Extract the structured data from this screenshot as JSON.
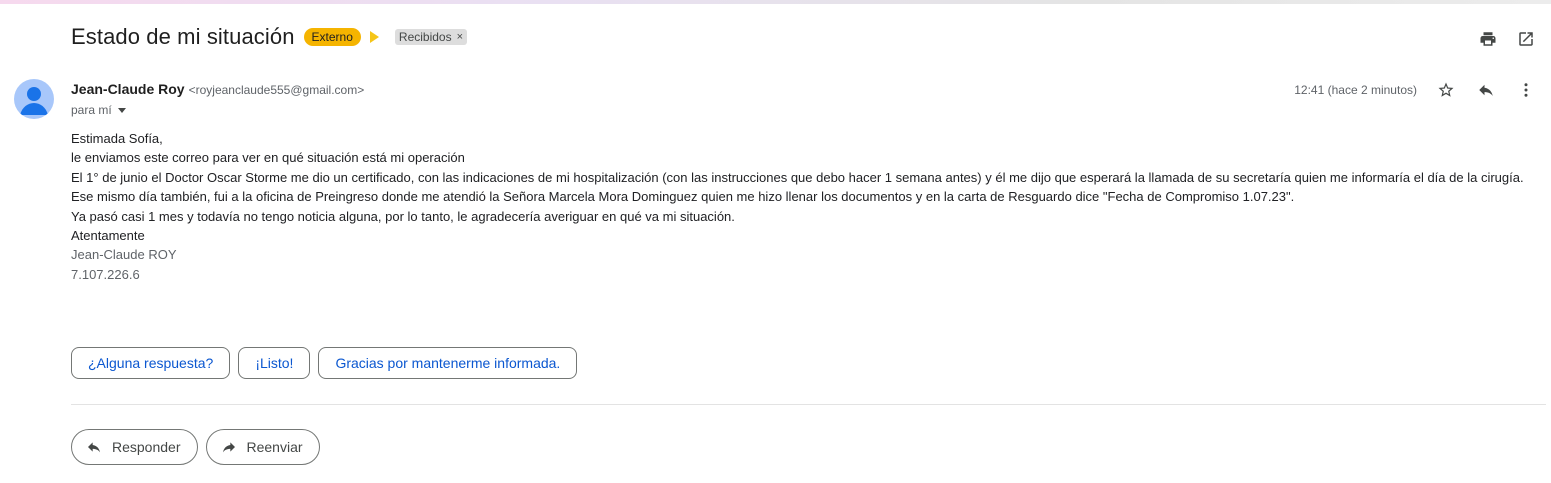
{
  "header": {
    "subject": "Estado de mi situación",
    "external_badge": "Externo",
    "label": "Recibidos",
    "label_remove": "×"
  },
  "sender": {
    "name": "Jean-Claude Roy",
    "email": "<royjeanclaude555@gmail.com>",
    "to": "para mí",
    "time": "12:41 (hace 2 minutos)"
  },
  "body": {
    "lines": [
      "Estimada Sofía,",
      "le enviamos este correo para  ver en qué situación está mi operación",
      "El 1° de junio el Doctor Oscar Storme me dio un certificado, con las indicaciones de mi hospitalización (con las instrucciones que debo hacer 1 semana antes) y él me dijo que esperará la llamada de su secretaría quien me informaría el día de la cirugía.",
      "Ese mismo día también, fui a la oficina de Preingreso donde me atendió la Señora Marcela Mora Dominguez quien me hizo llenar  los documentos y en la carta de Resguardo dice \"Fecha de Compromiso 1.07.23\".",
      "Ya pasó casi 1 mes y todavía no tengo noticia alguna, por lo tanto, le agradecería averiguar en qué va mi situación.",
      "Atentamente"
    ],
    "signature": [
      "Jean-Claude ROY",
      "7.107.226.6"
    ]
  },
  "smart_replies": [
    "¿Alguna respuesta?",
    "¡Listo!",
    "Gracias por mantenerme informada."
  ],
  "actions": {
    "reply": "Responder",
    "forward": "Reenviar"
  },
  "colors": {
    "external_badge": "#f5b400",
    "link_blue": "#0b57d0",
    "avatar": "#a8c7fa",
    "avatar_figure": "#1a73e8"
  },
  "icons": [
    "print-icon",
    "open-in-new-window-icon",
    "star-icon",
    "reply-icon",
    "more-vert-icon",
    "forward-icon",
    "importance-marker-icon",
    "person-icon"
  ]
}
